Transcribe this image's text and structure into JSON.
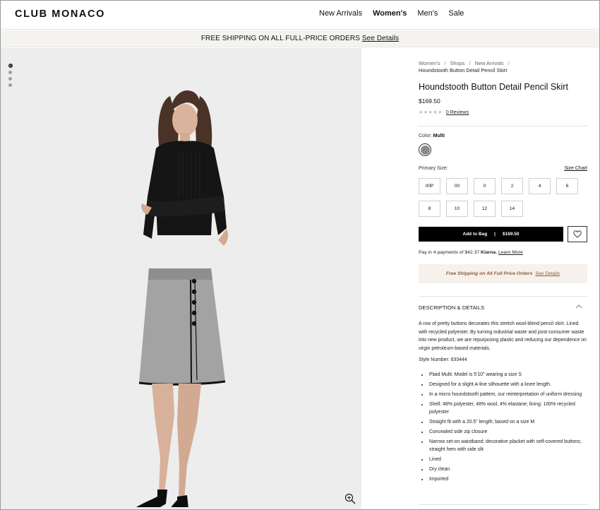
{
  "header": {
    "logo": "CLUB MONACO",
    "nav": [
      "New Arrivals",
      "Women's",
      "Men's",
      "Sale"
    ],
    "active_nav": "Women's"
  },
  "promo": {
    "text": "FREE SHIPPING ON ALL FULL-PRICE ORDERS",
    "link": "See Details"
  },
  "gallery": {
    "slide_count": 4,
    "active_slide": 1
  },
  "breadcrumb": {
    "items": [
      "Women's",
      "Shops",
      "New Arrivals"
    ],
    "separator": "/",
    "current": "Houndstooth Button Detail Pencil Skirt"
  },
  "product": {
    "title": "Houndstooth Button Detail Pencil Skirt",
    "price": "$169.50",
    "rating_stars": "★★★★★",
    "reviews_link": "0 Reviews",
    "color_label": "Color:",
    "color_value": "Multi",
    "swatch_color": "#8b8b8b",
    "size_label": "Primary Size:",
    "size_chart": "Size Chart",
    "sizes": [
      "00P",
      "00",
      "0",
      "2",
      "4",
      "6",
      "8",
      "10",
      "12",
      "14"
    ],
    "add_to_bag": "Add to Bag",
    "bag_separator": "|",
    "bag_price": "$169.50",
    "klarna_text": "Pay in 4 payments of $42.37",
    "klarna_brand": "Klarna.",
    "klarna_link": "Learn More",
    "shipping_text": "Free Shipping on All Full Price Orders",
    "shipping_link": "See Details"
  },
  "details": {
    "heading": "DESCRIPTION & DETAILS",
    "description": "A row of pretty buttons decorates this stretch wool-blend pencil skirt. Lined with recycled polyester. By turning industrial waste and post-consumer waste into new product, we are repurposing plastic and reducing our dependence on virgin petroleum-based materials.",
    "style_number": "Style Number: 633444",
    "bullets": [
      "Plaid Multi: Model is 5'10\" wearing a size S",
      "Designed for a slight A-line silhouette with a knee length.",
      "In a micro houndstooth pattern, our reinterpretation of uniform dressing",
      "Shell: 48% polyester, 48% wool, 4% elastane; lining: 100% recycled polyester",
      "Straight fit with a 20.5\" length; based on a size M",
      "Concealed side zip closure",
      "Narrow set-on waistband; decorative placket with self-covered buttons; straight hem with side slit",
      "Lined",
      "Dry clean",
      "Imported"
    ]
  }
}
